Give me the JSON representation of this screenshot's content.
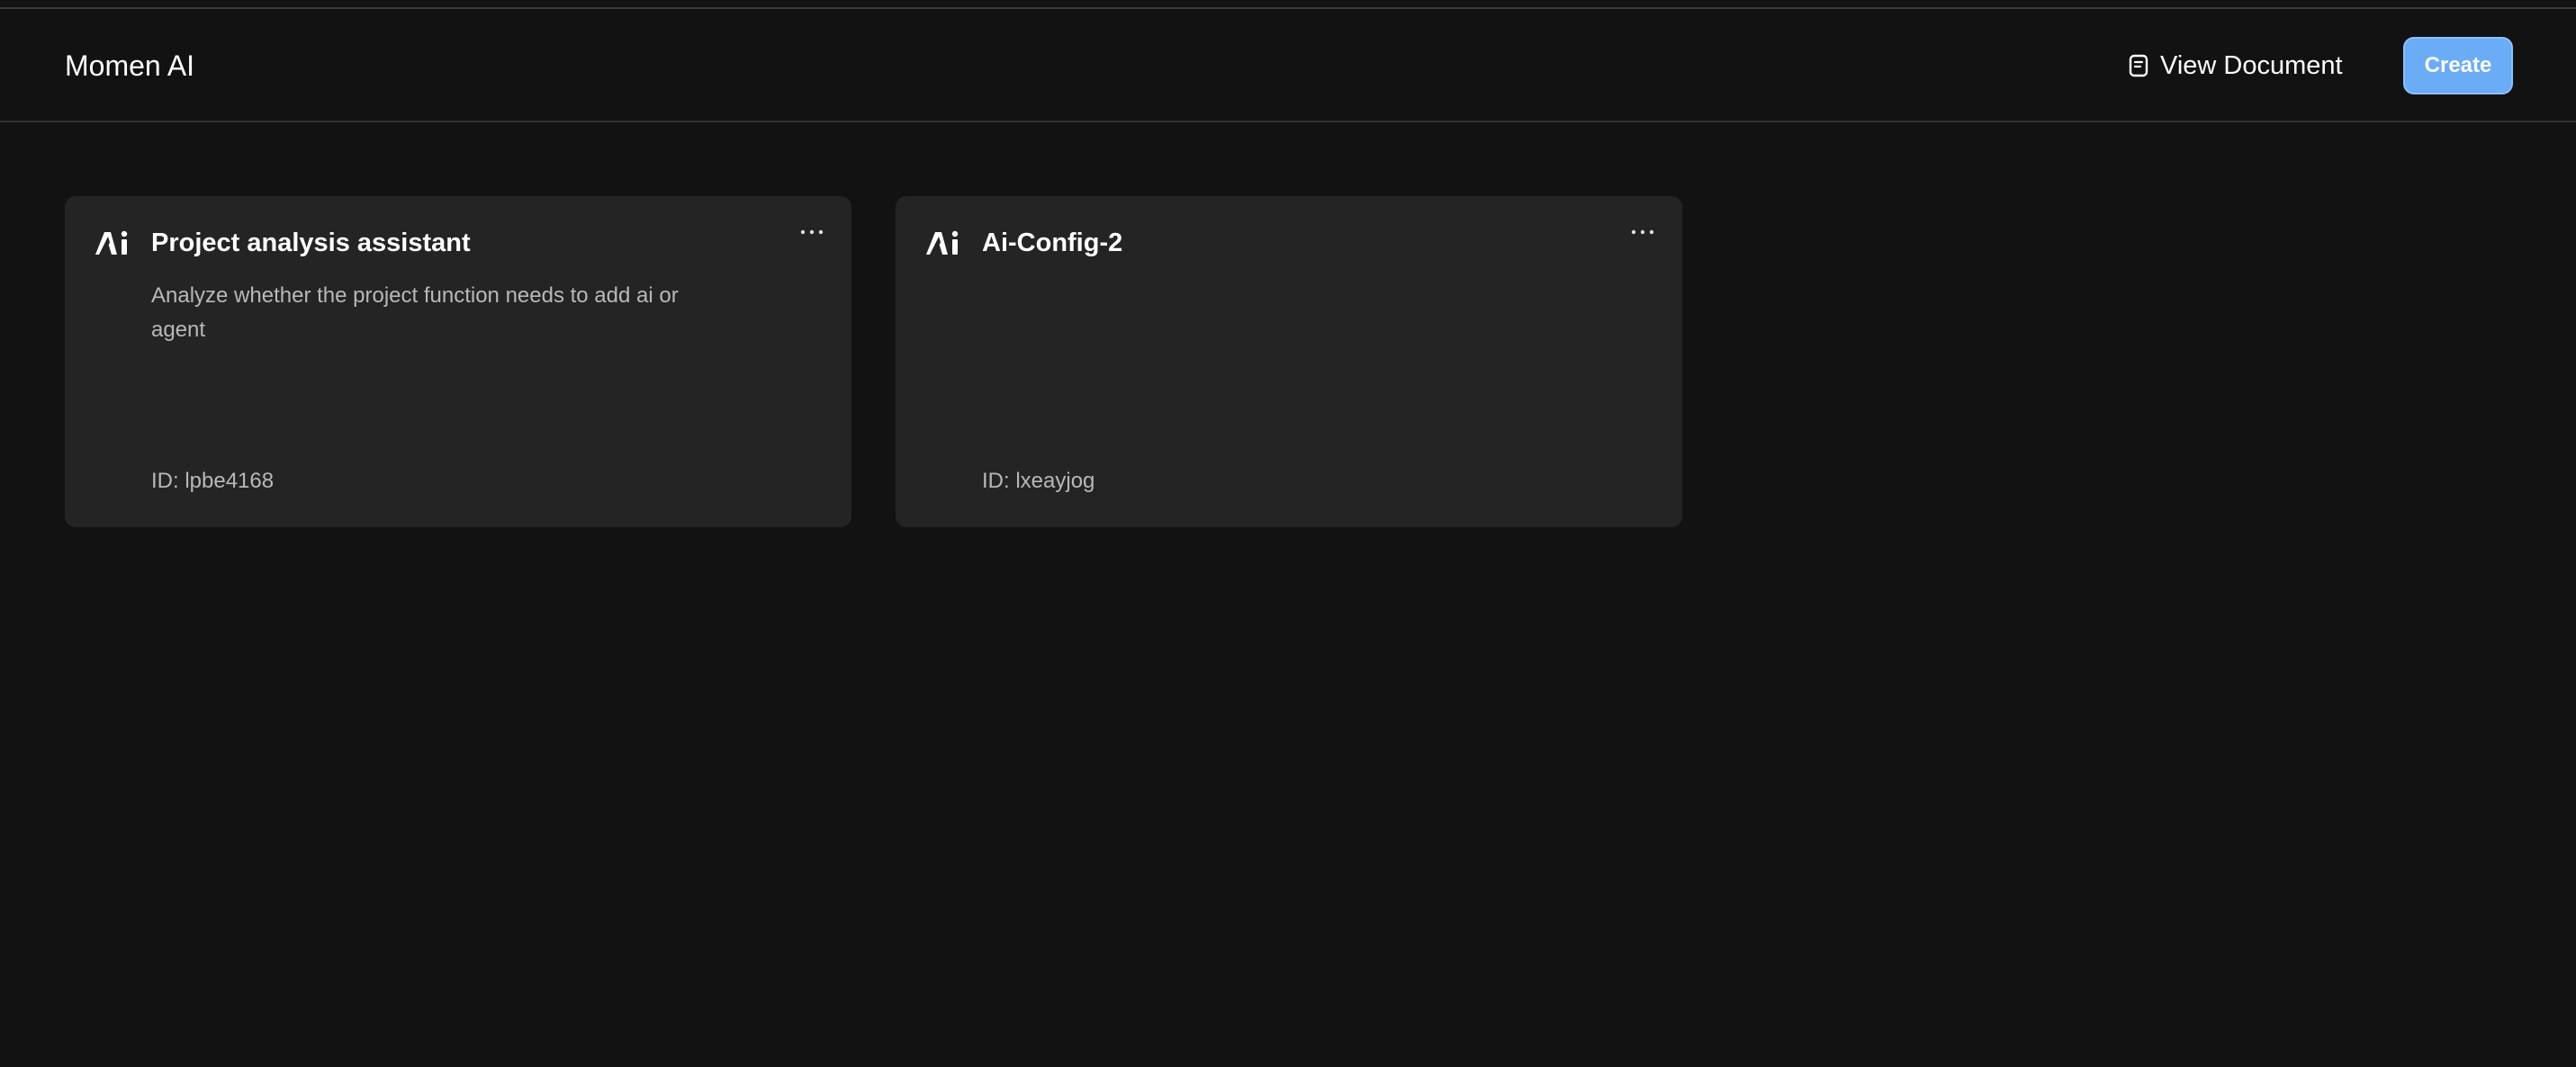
{
  "header": {
    "app_title": "Momen AI",
    "view_document_label": "View Document",
    "view_document_icon": "document-icon",
    "create_label": "Create",
    "accent_color": "#6aacf5"
  },
  "cards": [
    {
      "icon": "ai-logo-icon",
      "title": "Project analysis assistant",
      "description": "Analyze whether the project function needs to add ai or agent",
      "id_label": "ID: lpbe4168",
      "menu_icon": "more-horizontal-icon"
    },
    {
      "icon": "ai-logo-icon",
      "title": "Ai-Config-2",
      "description": "",
      "id_label": "ID: lxeayjog",
      "menu_icon": "more-horizontal-icon"
    }
  ]
}
